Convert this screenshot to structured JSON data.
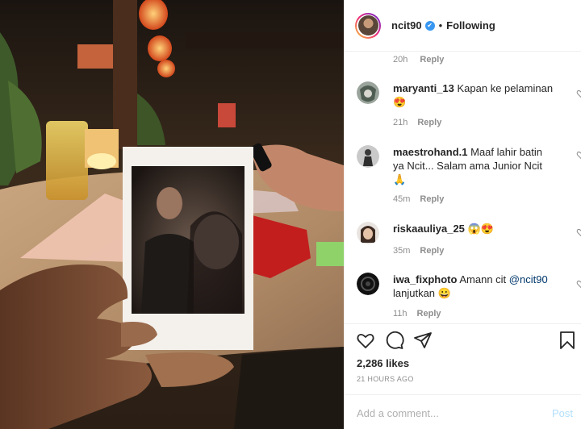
{
  "header": {
    "username": "ncit90",
    "verified_mark": "✔",
    "separator": "•",
    "follow_status": "Following"
  },
  "comments": {
    "partial": {
      "time": "20h",
      "reply": "Reply"
    },
    "items": [
      {
        "user": "maryanti_13",
        "text": "Kapan ke pelaminan😍",
        "time": "21h",
        "reply": "Reply",
        "avatar": "maryanti-avatar"
      },
      {
        "user": "maestrohand.1",
        "text": "Maaf lahir batin ya Ncit... Salam ama Junior Ncit 🙏",
        "time": "45m",
        "reply": "Reply",
        "avatar": "maestrohand-avatar"
      },
      {
        "user": "riskaauliya_25",
        "text": "😱😍",
        "time": "35m",
        "reply": "Reply",
        "avatar": "riskaauliya-avatar"
      },
      {
        "user": "iwa_fixphoto",
        "text_before": "Amann cit",
        "mention": "@ncit90",
        "text_after": "lanjutkan 😀",
        "time": "11h",
        "reply": "Reply",
        "avatar": "iwa-avatar"
      }
    ]
  },
  "actions": {
    "icons": [
      "heart-icon",
      "comment-icon",
      "share-icon",
      "bookmark-icon"
    ]
  },
  "likes": "2,286 likes",
  "timestamp": "21 HOURS AGO",
  "add_comment": {
    "placeholder": "Add a comment...",
    "post_label": "Post"
  },
  "colors": {
    "verified": "#3897f0",
    "mention": "#00376b",
    "post_disabled": "#b2dffc",
    "muted": "#8e8e8e"
  }
}
